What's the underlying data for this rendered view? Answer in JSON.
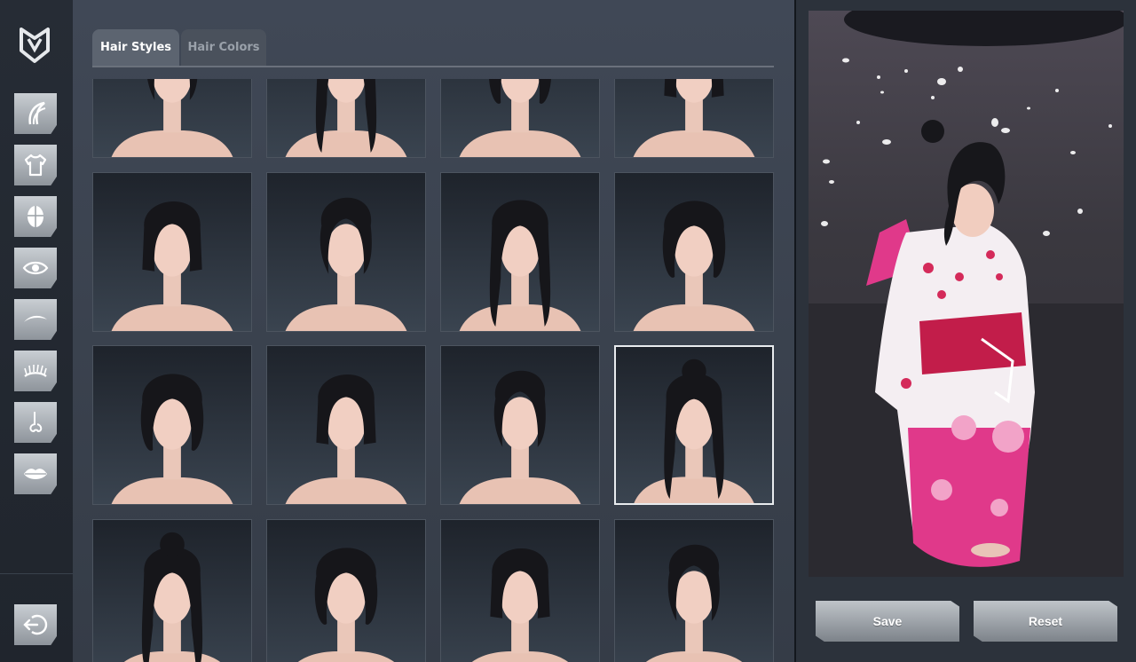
{
  "sidebar": {
    "logo": "shield-v-logo",
    "items": [
      {
        "id": "hair",
        "icon": "hair-icon"
      },
      {
        "id": "clothing",
        "icon": "shirt-icon"
      },
      {
        "id": "face-shape",
        "icon": "head-icon"
      },
      {
        "id": "eyes",
        "icon": "eye-icon"
      },
      {
        "id": "eyebrows",
        "icon": "eyebrow-icon"
      },
      {
        "id": "eyelashes",
        "icon": "eyelash-icon"
      },
      {
        "id": "nose",
        "icon": "nose-icon"
      },
      {
        "id": "lips",
        "icon": "lips-icon"
      }
    ],
    "exit_icon": "exit-icon"
  },
  "tabs": [
    {
      "label": "Hair Styles",
      "active": true
    },
    {
      "label": "Hair Colors",
      "active": false
    }
  ],
  "hair_styles": {
    "rows": 4,
    "columns": 4,
    "selected_index": 11,
    "items": [
      "updo-short",
      "bob-bangs",
      "bob-classic",
      "short-straight",
      "layered-bangs",
      "long-straight",
      "wavy-medium",
      "long-shaggy",
      "pixie",
      "messy-volume",
      "long-sleek",
      "high-bun-loose",
      "double-bun-bangs",
      "side-ponytail",
      "long-side-part",
      "low-ponytail"
    ]
  },
  "actions": {
    "save_label": "Save",
    "reset_label": "Reset"
  },
  "colors": {
    "accent_light": "#c9ced3",
    "panel": "#3b424e",
    "kimono_pink": "#e0398a"
  }
}
